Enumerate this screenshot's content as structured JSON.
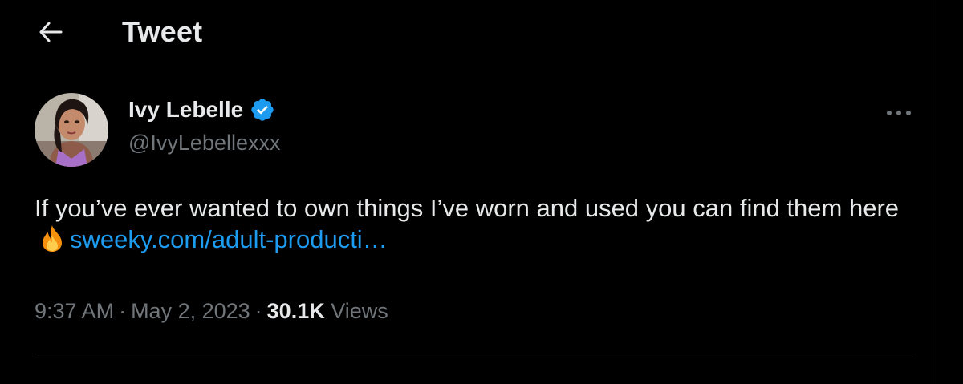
{
  "header": {
    "title": "Tweet",
    "back_icon": "arrow-left-icon"
  },
  "author": {
    "name": "Ivy Lebelle",
    "handle": "@IvyLebellexxx",
    "verified_icon": "verified-badge-icon",
    "verified_color": "#1d9bf0"
  },
  "more_icon": "ellipsis-horizontal-icon",
  "tweet": {
    "text_before": "If you’ve ever wanted to own things I’ve worn and used you can find them here ",
    "emoji_icon": "fire-emoji-icon",
    "link_text": "sweeky.com/adult-producti…"
  },
  "meta": {
    "time": "9:37 AM",
    "date": "May 2, 2023",
    "separator": "·",
    "views_count": "30.1K",
    "views_label": "Views"
  },
  "colors": {
    "background": "#000000",
    "text_primary": "#e7e9ea",
    "text_secondary": "#71767b",
    "link": "#1d9bf0",
    "divider": "#2f3336"
  }
}
